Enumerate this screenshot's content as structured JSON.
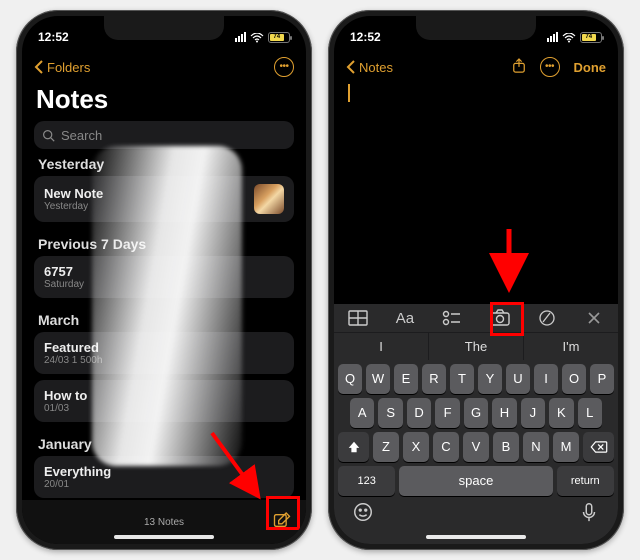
{
  "status": {
    "time": "12:52",
    "battery": "74"
  },
  "phone1": {
    "nav_back": "Folders",
    "title": "Notes",
    "search_placeholder": "Search",
    "footer_count": "13 Notes",
    "groups": [
      {
        "header": "Yesterday",
        "notes": [
          {
            "title": "New Note",
            "sub": "Yesterday",
            "thumb": true
          }
        ]
      },
      {
        "header": "Previous 7 Days",
        "notes": [
          {
            "title": "6757",
            "sub": "Saturday"
          }
        ]
      },
      {
        "header": "March",
        "notes": [
          {
            "title": "Featured",
            "sub": "24/03",
            "right": "1 500h"
          },
          {
            "title": "How to",
            "sub": "01/03"
          }
        ]
      },
      {
        "header": "January",
        "notes": [
          {
            "title": "Everything",
            "sub": "20/01"
          }
        ]
      }
    ]
  },
  "phone2": {
    "nav_back": "Notes",
    "done": "Done",
    "predictions": [
      "I",
      "The",
      "I'm"
    ],
    "rows": {
      "r1": [
        "Q",
        "W",
        "E",
        "R",
        "T",
        "Y",
        "U",
        "I",
        "O",
        "P"
      ],
      "r2": [
        "A",
        "S",
        "D",
        "F",
        "G",
        "H",
        "J",
        "K",
        "L"
      ],
      "r3": [
        "Z",
        "X",
        "C",
        "V",
        "B",
        "N",
        "M"
      ]
    },
    "num_key": "123",
    "space_key": "space",
    "return_key": "return",
    "aa_label": "Aa"
  }
}
